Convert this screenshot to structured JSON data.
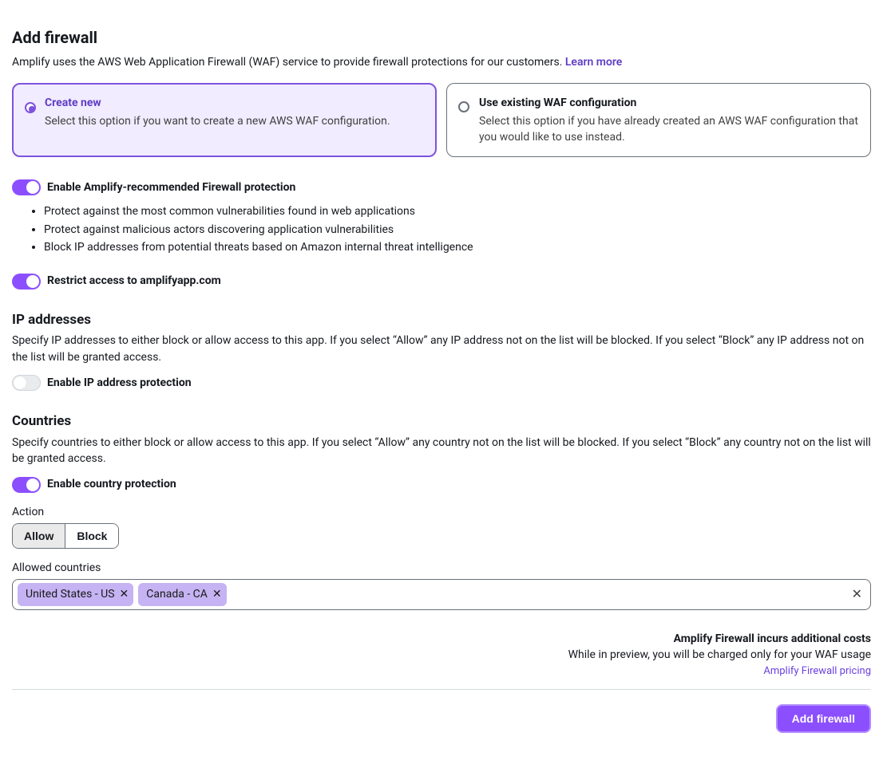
{
  "header": {
    "title": "Add firewall",
    "intro": "Amplify uses the AWS Web Application Firewall (WAF) service to provide firewall protections for our customers. ",
    "learn_more": "Learn more"
  },
  "tiles": {
    "create": {
      "title": "Create new",
      "desc": "Select this option if you want to create a new AWS WAF configuration."
    },
    "existing": {
      "title": "Use existing WAF configuration",
      "desc": "Select this option if you have already created an AWS WAF configuration that you would like to use instead."
    }
  },
  "recommended": {
    "label": "Enable Amplify-recommended Firewall protection",
    "bullets": [
      "Protect against the most common vulnerabilities found in web applications",
      "Protect against malicious actors discovering application vulnerabilities",
      "Block IP addresses from potential threats based on Amazon internal threat intelligence"
    ]
  },
  "restrict": {
    "label": "Restrict access to amplifyapp.com"
  },
  "ip": {
    "title": "IP addresses",
    "desc": "Specify IP addresses to either block or allow access to this app. If you select “Allow” any IP address not on the list will be blocked. If you select “Block” any IP address not on the list will be granted access.",
    "toggle_label": "Enable IP address protection"
  },
  "countries": {
    "title": "Countries",
    "desc": "Specify countries to either block or allow access to this app. If you select “Allow” any country not on the list will be blocked. If you select “Block” any country not on the list will be granted access.",
    "toggle_label": "Enable country protection",
    "action_label": "Action",
    "allow": "Allow",
    "block": "Block",
    "allowed_label": "Allowed countries",
    "tokens": [
      "United States - US",
      "Canada - CA"
    ]
  },
  "costs": {
    "line1": "Amplify Firewall incurs additional costs",
    "line2": "While in preview, you will be charged only for your WAF usage",
    "link": "Amplify Firewall pricing"
  },
  "actions": {
    "submit": "Add firewall"
  }
}
